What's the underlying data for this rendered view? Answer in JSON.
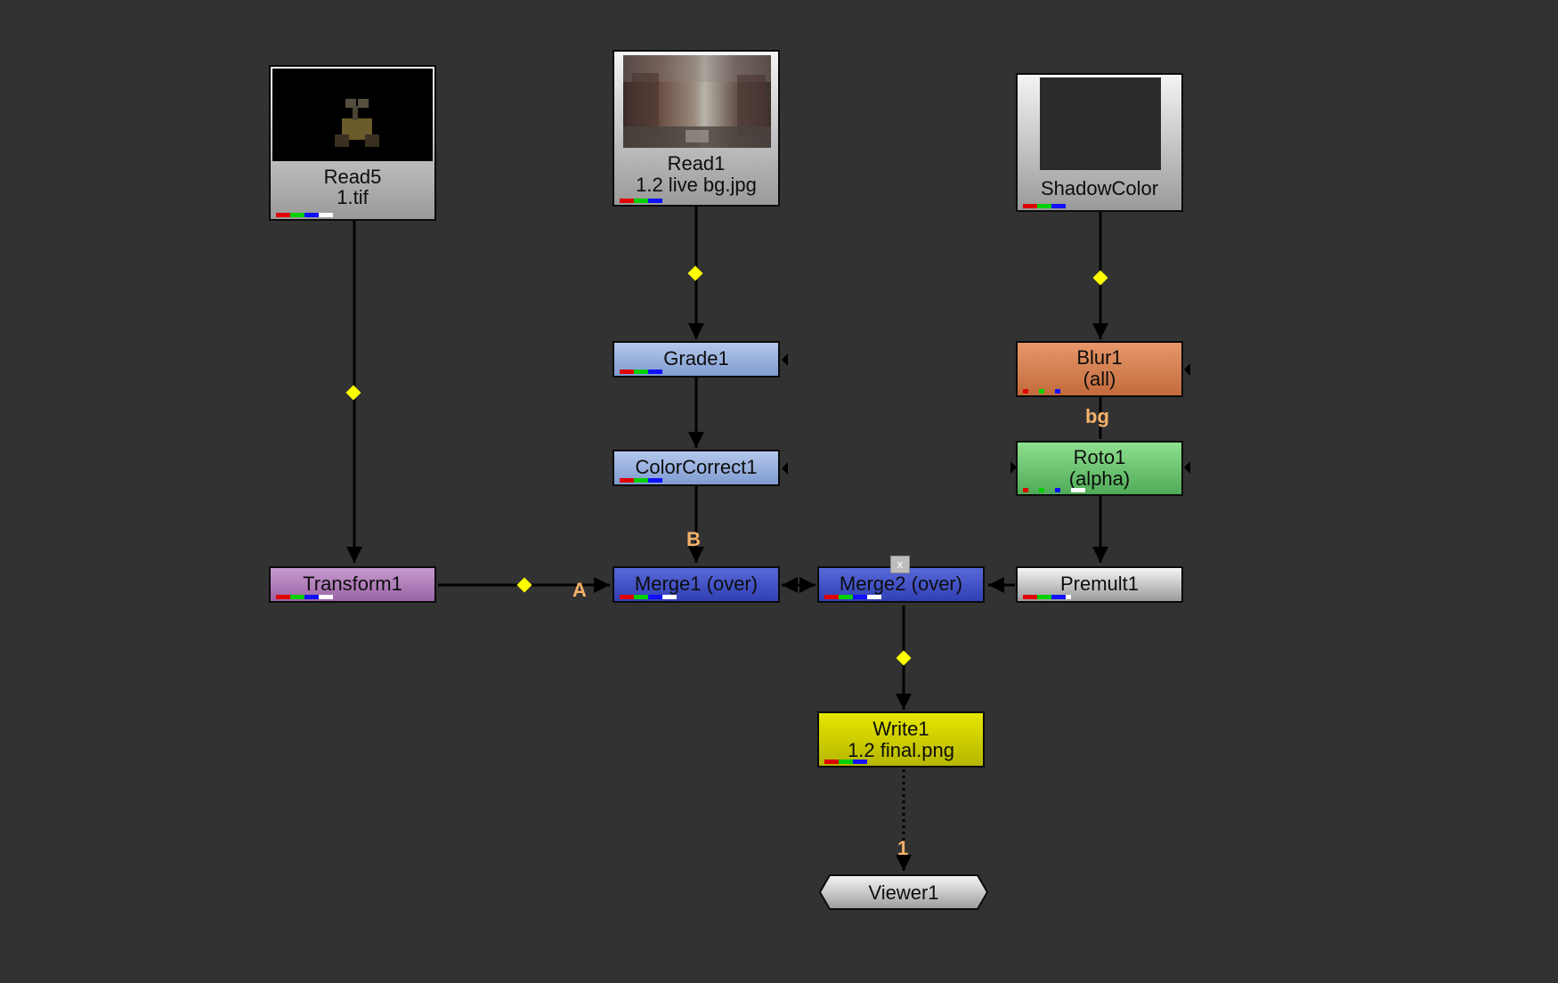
{
  "nodes": {
    "read5": {
      "title": "Read5",
      "subtitle": "1.tif"
    },
    "read1": {
      "title": "Read1",
      "subtitle": "1.2 live bg.jpg"
    },
    "shadowcolor": {
      "title": "ShadowColor"
    },
    "grade1": {
      "title": "Grade1"
    },
    "colorcorrect1": {
      "title": "ColorCorrect1"
    },
    "blur1": {
      "title": "Blur1",
      "subtitle": "(all)"
    },
    "roto1": {
      "title": "Roto1",
      "subtitle": "(alpha)"
    },
    "transform1": {
      "title": "Transform1"
    },
    "merge1": {
      "title": "Merge1 (over)"
    },
    "merge2": {
      "title": "Merge2 (over)",
      "close": "x"
    },
    "premult1": {
      "title": "Premult1"
    },
    "write1": {
      "title": "Write1",
      "subtitle": "1.2 final.png"
    },
    "viewer1": {
      "title": "Viewer1"
    }
  },
  "input_labels": {
    "merge1_a": "A",
    "merge1_b": "B",
    "roto_bg": "bg",
    "viewer_input": "1"
  },
  "colors": {
    "background": "#323232",
    "pipe": "#000000",
    "dot": "#ffff00",
    "input_label": "#f5b26a"
  }
}
